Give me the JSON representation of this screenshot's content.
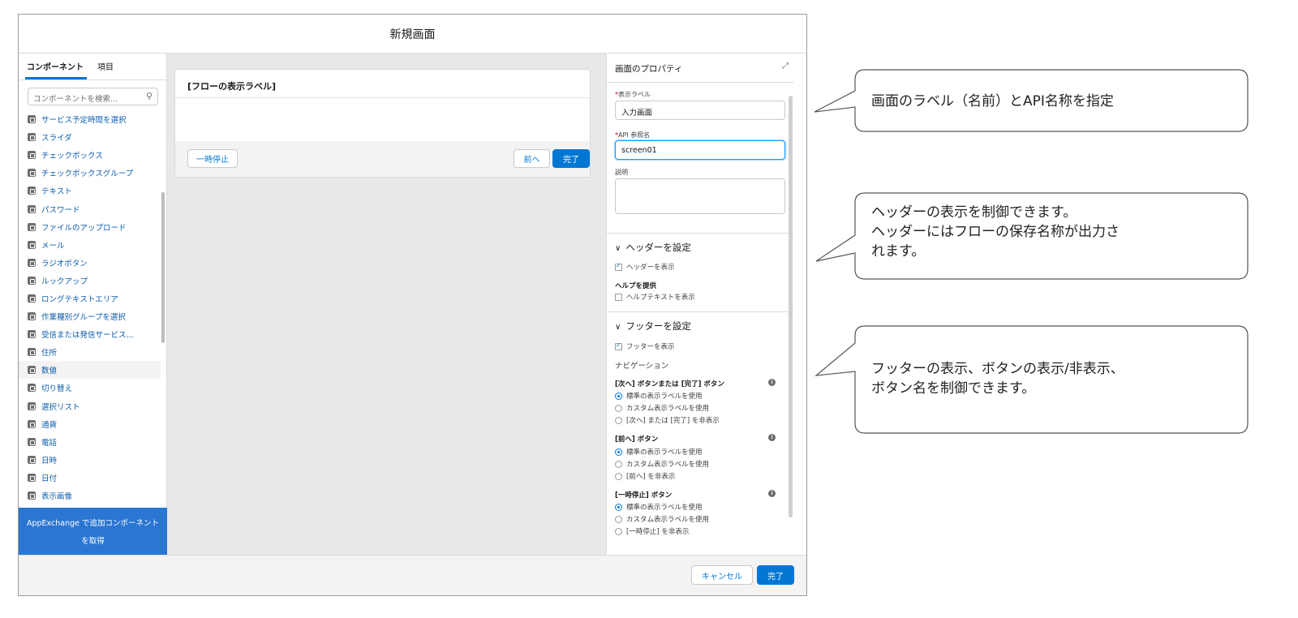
{
  "dialog": {
    "title": "新規画面",
    "cancel_label": "キャンセル",
    "done_label": "完了"
  },
  "palette": {
    "tab_components": "コンポーネント",
    "tab_fields": "項目",
    "search_placeholder": "コンポーネントを検索...",
    "items": [
      "サービス予定時間を選択",
      "スライダ",
      "チェックボックス",
      "チェックボックスグループ",
      "テキスト",
      "パスワード",
      "ファイルのアップロード",
      "メール",
      "ラジオボタン",
      "ルックアップ",
      "ロングテキストエリア",
      "作業種別グループを選択",
      "受信または発信サービス...",
      "住所",
      "数値",
      "切り替え",
      "選択リスト",
      "通貨",
      "電話",
      "日時",
      "日付",
      "表示画像"
    ],
    "selected_item": "数値",
    "appexchange_label": "AppExchange で追加コンポーネントを取得"
  },
  "canvas": {
    "screen_title": "[フローの表示ラベル]",
    "pause_label": "一時停止",
    "prev_label": "前へ",
    "finish_label": "完了"
  },
  "properties": {
    "title": "画面のプロパティ",
    "label_field_label": "表示ラベル",
    "label_field_value": "入力画面",
    "api_field_label": "API 参照名",
    "api_field_value": "screen01",
    "description_label": "説明",
    "header_section": "ヘッダーを設定",
    "show_header": "ヘッダーを表示",
    "help_heading": "ヘルプを提供",
    "show_help_text": "ヘルプテキストを表示",
    "footer_section": "フッターを設定",
    "show_footer": "フッターを表示",
    "navigation": "ナビゲーション",
    "next_finish_heading": "[次へ] ボタンまたは [完了] ボタン",
    "prev_heading": "[前へ] ボタン",
    "pause_heading": "[一時停止] ボタン",
    "opt_standard": "標準の表示ラベルを使用",
    "opt_custom": "カスタム表示ラベルを使用",
    "opt_hide_next_finish": "[次へ] または [完了] を非表示",
    "opt_hide_prev": "[前へ] を非表示",
    "opt_hide_pause": "[一時停止] を非表示"
  },
  "callouts": {
    "c1": "画面のラベル（名前）とAPI名称を指定",
    "c2_line1": "ヘッダーの表示を制御できます。",
    "c2_line2": "ヘッダーにはフローの保存名称が出力さ",
    "c2_line3": "れます。",
    "c3_line1": "フッターの表示、ボタンの表示/非表示、",
    "c3_line2": "ボタン名を制御できます。"
  }
}
